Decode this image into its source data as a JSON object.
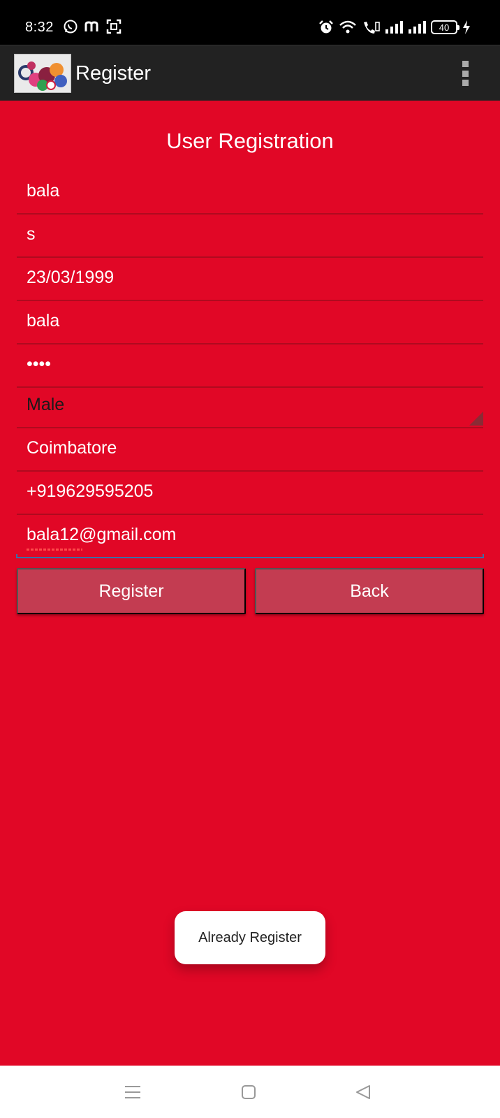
{
  "status_bar": {
    "time": "8:32",
    "battery": "40",
    "icons": [
      "whatsapp-icon",
      "m-app-icon",
      "scan-icon",
      "alarm-icon",
      "wifi-icon",
      "wifi-calling-icon",
      "signal-icon",
      "signal-icon",
      "battery-icon",
      "charging-icon"
    ]
  },
  "action_bar": {
    "title": "Register",
    "logo": "app-logo-image",
    "menu_icon": "overflow-menu-icon"
  },
  "form": {
    "title": "User Registration",
    "first_name": "bala",
    "last_name": "s",
    "dob": "23/03/1999",
    "username": "bala",
    "password": "••••",
    "gender": "Male",
    "city": "Coimbatore",
    "phone": "+919629595205",
    "email": "bala12@gmail.com"
  },
  "buttons": {
    "register": "Register",
    "back": "Back"
  },
  "toast": {
    "message": "Already Register"
  },
  "nav_bar": {
    "icons": [
      "recents-menu-icon",
      "home-icon",
      "back-icon"
    ]
  },
  "colors": {
    "background": "#e10726",
    "button": "#c33c51",
    "action_bar": "#222222",
    "status_bar": "#000000"
  }
}
